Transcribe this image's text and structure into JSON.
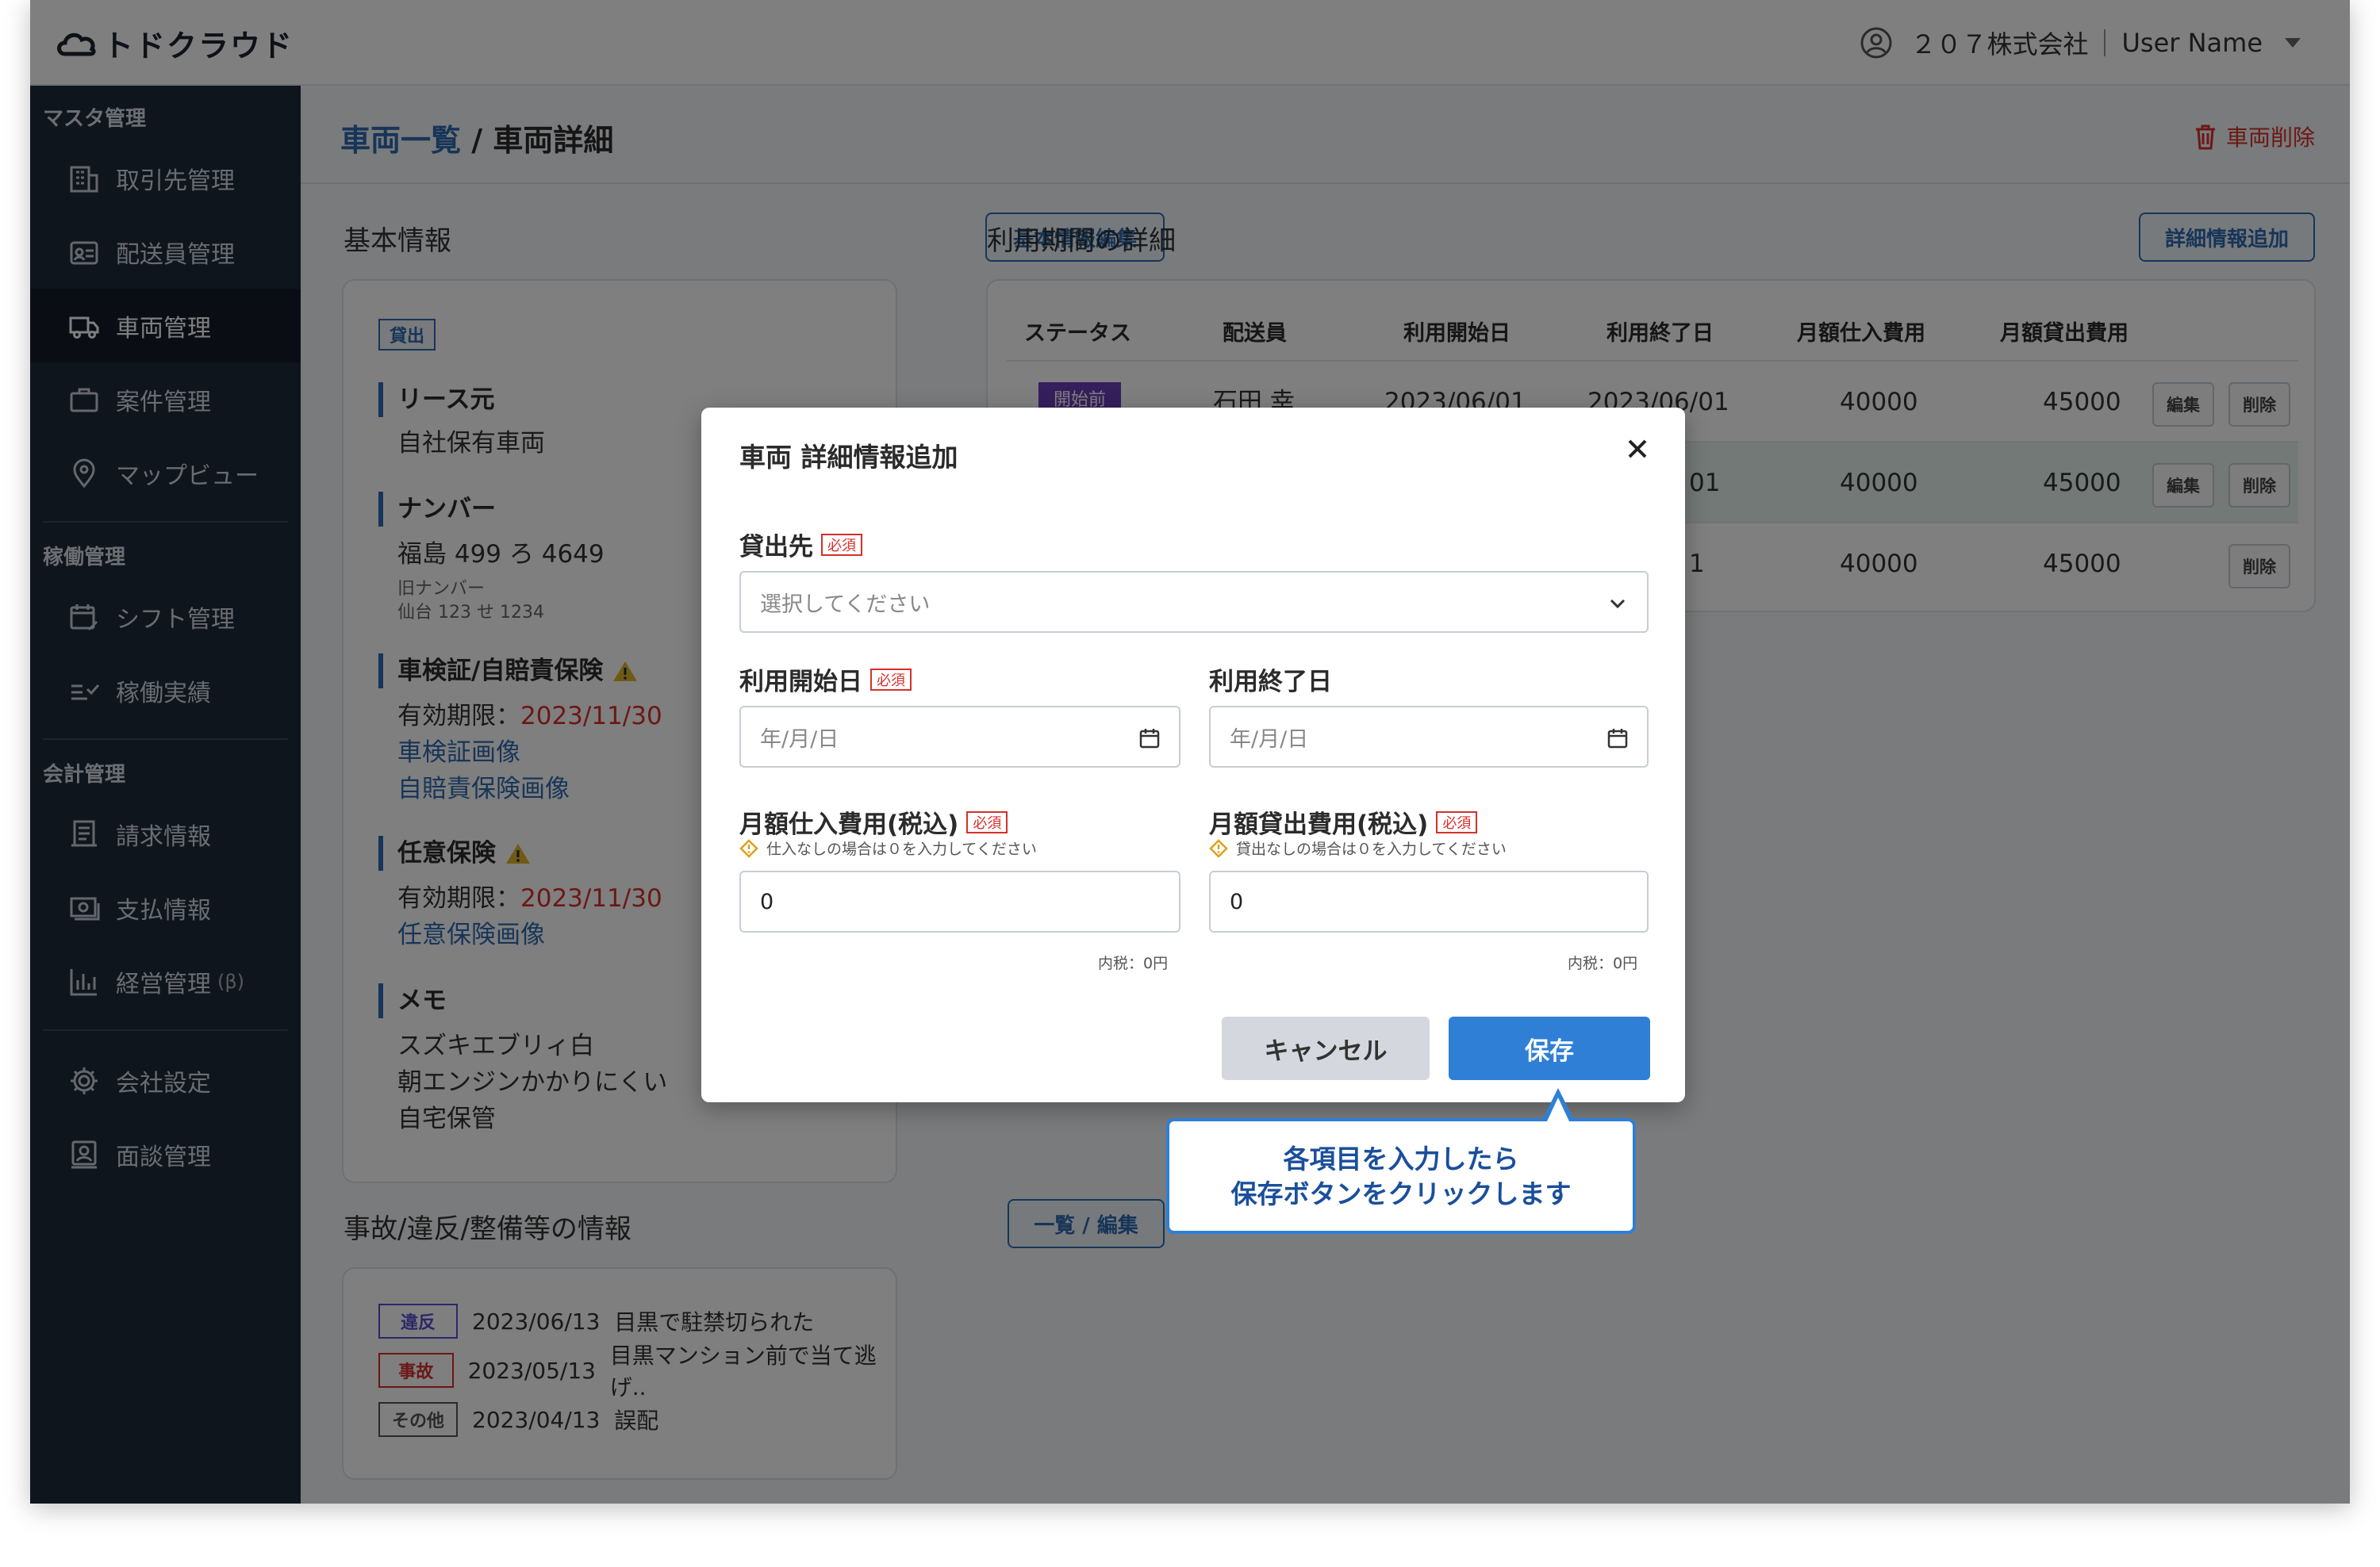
{
  "brand": {
    "logo_text": "トドクラウド"
  },
  "header": {
    "company": "２０７株式会社",
    "user_name": "User Name"
  },
  "sidebar": {
    "sections": [
      {
        "title": "マスタ管理",
        "items": [
          {
            "label": "取引先管理",
            "icon": "building-icon"
          },
          {
            "label": "配送員管理",
            "icon": "id-card-icon"
          },
          {
            "label": "車両管理",
            "icon": "truck-icon",
            "active": true
          },
          {
            "label": "案件管理",
            "icon": "briefcase-icon"
          },
          {
            "label": "マップビュー",
            "icon": "map-pin-icon"
          }
        ]
      },
      {
        "title": "稼働管理",
        "items": [
          {
            "label": "シフト管理",
            "icon": "calendar-edit-icon"
          },
          {
            "label": "稼働実績",
            "icon": "checklist-icon"
          }
        ]
      },
      {
        "title": "会計管理",
        "items": [
          {
            "label": "請求情報",
            "icon": "invoice-icon"
          },
          {
            "label": "支払情報",
            "icon": "payment-icon"
          },
          {
            "label": "経営管理",
            "suffix": "(β)",
            "icon": "bar-chart-icon"
          }
        ]
      },
      {
        "title": "",
        "items": [
          {
            "label": "会社設定",
            "icon": "gear-icon"
          },
          {
            "label": "面談管理",
            "icon": "interview-icon"
          }
        ]
      }
    ]
  },
  "breadcrumb": {
    "parent": "車両一覧",
    "separator": " / ",
    "current": "車両詳細"
  },
  "delete_vehicle_label": "車両削除",
  "basic_info": {
    "title": "基本情報",
    "edit_button": "基本情報編集",
    "status_tag": "貸出",
    "lease_label": "リース元",
    "lease_value": "自社保有車両",
    "number_label": "ナンバー",
    "number_value": "福島 499 ろ 4649",
    "old_number_label": "旧ナンバー",
    "old_number_value": "仙台 123 せ 1234",
    "inspection_label": "車検証/自賠責保険",
    "inspection_expiry_label": "有効期限：",
    "inspection_expiry": "2023/11/30",
    "inspection_link1": "車検証画像",
    "inspection_link2": "自賠責保険画像",
    "optional_label": "任意保険",
    "optional_expiry_label": "有効期限：",
    "optional_expiry": "2023/11/30",
    "optional_link": "任意保険画像",
    "memo_label": "メモ",
    "memo_lines": [
      "スズキエブリィ白",
      "朝エンジンかかりにくい",
      "自宅保管"
    ]
  },
  "incidents": {
    "title": "事故/違反/整備等の情報",
    "button": "一覧 / 編集",
    "items": [
      {
        "tag": "違反",
        "color": "#5a4fcf",
        "date": "2023/06/13",
        "text": "目黒で駐禁切られた"
      },
      {
        "tag": "事故",
        "color": "#d6302b",
        "date": "2023/05/13",
        "text": "目黒マンション前で当て逃げ.."
      },
      {
        "tag": "その他",
        "color": "#555555",
        "date": "2023/04/13",
        "text": "誤配"
      }
    ]
  },
  "usage": {
    "title": "利用期間の詳細",
    "add_button": "詳細情報追加",
    "headers": [
      "ステータス",
      "配送員",
      "利用開始日",
      "利用終了日",
      "月額仕入費用",
      "月額貸出費用"
    ],
    "rows": [
      {
        "status": "開始前",
        "driver": "石田 幸",
        "start": "2023/06/01",
        "end": "2023/06/01",
        "purchase": "40000",
        "rental": "45000",
        "edit": "編集",
        "delete": "削除"
      },
      {
        "status": "",
        "driver": "",
        "start": "",
        "end": "01",
        "purchase": "40000",
        "rental": "45000",
        "edit": "編集",
        "delete": "削除"
      },
      {
        "status": "",
        "driver": "",
        "start": "",
        "end": "1",
        "purchase": "40000",
        "rental": "45000",
        "edit": "",
        "delete": "削除"
      }
    ]
  },
  "modal": {
    "title": "車両 詳細情報追加",
    "required": "必須",
    "lender_label": "貸出先",
    "lender_placeholder": "選択してください",
    "start_label": "利用開始日",
    "start_placeholder": "年/月/日",
    "end_label": "利用終了日",
    "end_placeholder": "年/月/日",
    "purchase_label": "月額仕入費用(税込)",
    "purchase_hint": "仕入なしの場合は０を入力してください",
    "purchase_value": "0",
    "purchase_tax": "内税：0円",
    "rental_label": "月額貸出費用(税込)",
    "rental_hint": "貸出なしの場合は０を入力してください",
    "rental_value": "0",
    "rental_tax": "内税：0円",
    "cancel": "キャンセル",
    "save": "保存"
  },
  "callout": {
    "line1": "各項目を入力したら",
    "line2": "保存ボタンをクリックします"
  },
  "colors": {
    "accent": "#2f6bb0",
    "sidebar": "#1f2a3b",
    "danger": "#d6302b",
    "save": "#2f7fd6"
  }
}
